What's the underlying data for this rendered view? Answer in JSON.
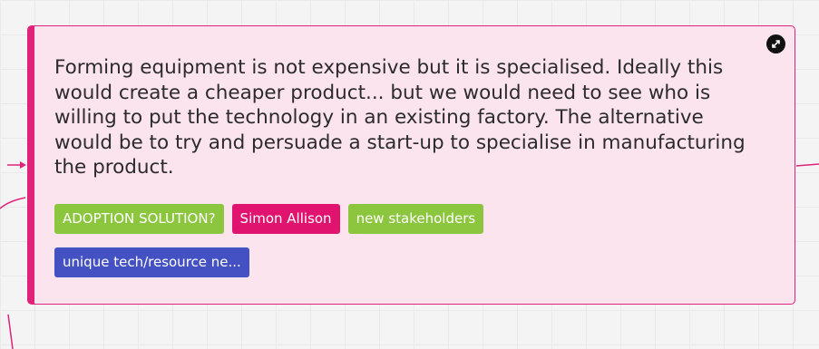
{
  "card": {
    "text": "Forming equipment is not expensive but it is specialised. Ideally this would create a cheaper product... but we would need to see who is willing to put the technology in an existing factory. The alternative would be to try and persuade a start-up to specialise in manufacturing the product.",
    "accent_color": "#e0237a",
    "background_color": "#fce4ef",
    "expand_icon": "expand-arrows-icon",
    "tags": [
      {
        "label": "ADOPTION SOLUTION?",
        "color": "#8cc63f"
      },
      {
        "label": "Simon Allison",
        "color": "#e0136f"
      },
      {
        "label": "new stakeholders",
        "color": "#8cc63f"
      },
      {
        "label": "unique tech/resource ne...",
        "color": "#4451c2"
      }
    ]
  }
}
